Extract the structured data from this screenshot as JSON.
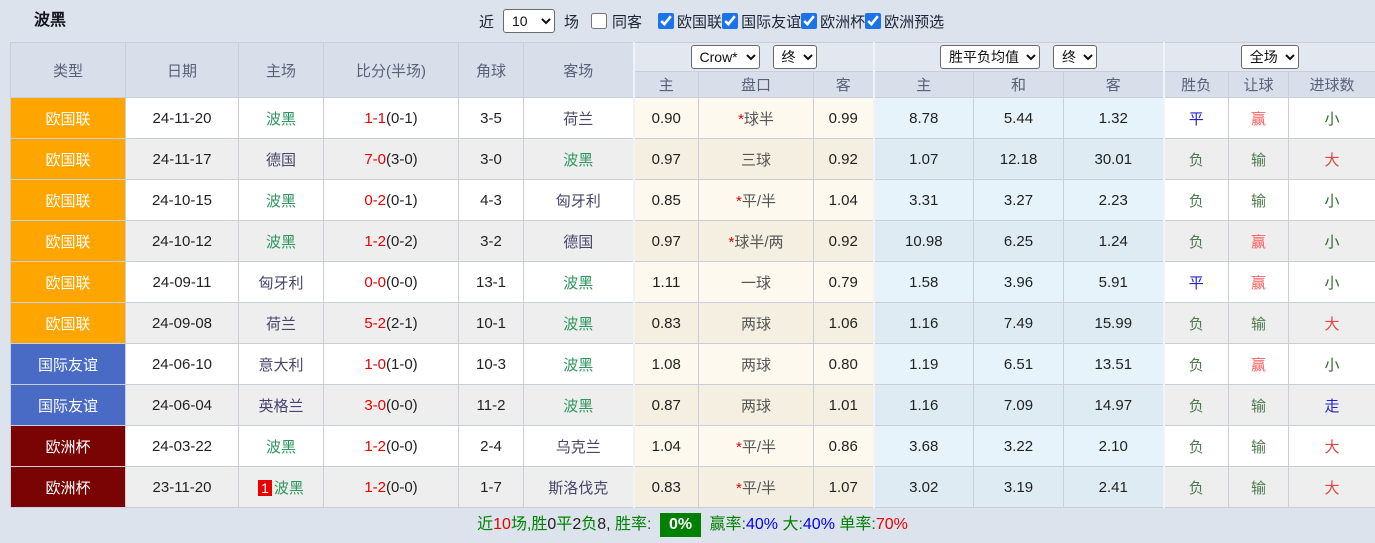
{
  "topbar": {
    "title": "波黑",
    "recent_label": "近",
    "recent_value": "10",
    "games_label": "场",
    "same_venue_label": "同客",
    "same_venue_checked": false,
    "filters": [
      {
        "label": "欧国联",
        "checked": true
      },
      {
        "label": "国际友谊",
        "checked": true
      },
      {
        "label": "欧洲杯",
        "checked": true
      },
      {
        "label": "欧洲预选",
        "checked": true
      }
    ]
  },
  "table": {
    "columns": [
      "类型",
      "日期",
      "主场",
      "比分(半场)",
      "角球",
      "客场"
    ],
    "selects": {
      "company": "Crow*",
      "time1": "终",
      "avg": "胜平负均值",
      "time2": "终",
      "scope": "全场"
    },
    "sub_headers": [
      "主",
      "盘口",
      "客",
      "主",
      "和",
      "客",
      "胜负",
      "让球",
      "进球数"
    ],
    "rows": [
      {
        "type": "欧国联",
        "type_key": "nations",
        "date": "24-11-20",
        "home": "波黑",
        "home_self": true,
        "home_badge": null,
        "score": "1-1",
        "half": "(0-1)",
        "corner": "3-5",
        "away": "荷兰",
        "away_self": false,
        "o_home": "0.90",
        "h_star": true,
        "handicap": "球半",
        "o_away": "0.99",
        "a_home": "8.78",
        "a_draw": "5.44",
        "a_away": "1.32",
        "res": "平",
        "res_c": "blue",
        "hres": "赢",
        "hres_c": "lightred",
        "goal": "小",
        "goal_c": "darkgreen"
      },
      {
        "type": "欧国联",
        "type_key": "nations",
        "date": "24-11-17",
        "home": "德国",
        "home_self": false,
        "home_badge": null,
        "score": "7-0",
        "half": "(3-0)",
        "corner": "3-0",
        "away": "波黑",
        "away_self": true,
        "o_home": "0.97",
        "h_star": false,
        "handicap": "三球",
        "o_away": "0.92",
        "a_home": "1.07",
        "a_draw": "12.18",
        "a_away": "30.01",
        "res": "负",
        "res_c": "green",
        "hres": "输",
        "hres_c": "green",
        "goal": "大",
        "goal_c": "red"
      },
      {
        "type": "欧国联",
        "type_key": "nations",
        "date": "24-10-15",
        "home": "波黑",
        "home_self": true,
        "home_badge": null,
        "score": "0-2",
        "half": "(0-1)",
        "corner": "4-3",
        "away": "匈牙利",
        "away_self": false,
        "o_home": "0.85",
        "h_star": true,
        "handicap": "平/半",
        "o_away": "1.04",
        "a_home": "3.31",
        "a_draw": "3.27",
        "a_away": "2.23",
        "res": "负",
        "res_c": "green",
        "hres": "输",
        "hres_c": "green",
        "goal": "小",
        "goal_c": "darkgreen"
      },
      {
        "type": "欧国联",
        "type_key": "nations",
        "date": "24-10-12",
        "home": "波黑",
        "home_self": true,
        "home_badge": null,
        "score": "1-2",
        "half": "(0-2)",
        "corner": "3-2",
        "away": "德国",
        "away_self": false,
        "o_home": "0.97",
        "h_star": true,
        "handicap": "球半/两",
        "o_away": "0.92",
        "a_home": "10.98",
        "a_draw": "6.25",
        "a_away": "1.24",
        "res": "负",
        "res_c": "green",
        "hres": "赢",
        "hres_c": "lightred",
        "goal": "小",
        "goal_c": "darkgreen"
      },
      {
        "type": "欧国联",
        "type_key": "nations",
        "date": "24-09-11",
        "home": "匈牙利",
        "home_self": false,
        "home_badge": null,
        "score": "0-0",
        "half": "(0-0)",
        "corner": "13-1",
        "away": "波黑",
        "away_self": true,
        "o_home": "1.11",
        "h_star": false,
        "handicap": "一球",
        "o_away": "0.79",
        "a_home": "1.58",
        "a_draw": "3.96",
        "a_away": "5.91",
        "res": "平",
        "res_c": "blue",
        "hres": "赢",
        "hres_c": "lightred",
        "goal": "小",
        "goal_c": "darkgreen"
      },
      {
        "type": "欧国联",
        "type_key": "nations",
        "date": "24-09-08",
        "home": "荷兰",
        "home_self": false,
        "home_badge": null,
        "score": "5-2",
        "half": "(2-1)",
        "corner": "10-1",
        "away": "波黑",
        "away_self": true,
        "o_home": "0.83",
        "h_star": false,
        "handicap": "两球",
        "o_away": "1.06",
        "a_home": "1.16",
        "a_draw": "7.49",
        "a_away": "15.99",
        "res": "负",
        "res_c": "green",
        "hres": "输",
        "hres_c": "green",
        "goal": "大",
        "goal_c": "red"
      },
      {
        "type": "国际友谊",
        "type_key": "friendly",
        "date": "24-06-10",
        "home": "意大利",
        "home_self": false,
        "home_badge": null,
        "score": "1-0",
        "half": "(1-0)",
        "corner": "10-3",
        "away": "波黑",
        "away_self": true,
        "o_home": "1.08",
        "h_star": false,
        "handicap": "两球",
        "o_away": "0.80",
        "a_home": "1.19",
        "a_draw": "6.51",
        "a_away": "13.51",
        "res": "负",
        "res_c": "green",
        "hres": "赢",
        "hres_c": "lightred",
        "goal": "小",
        "goal_c": "darkgreen"
      },
      {
        "type": "国际友谊",
        "type_key": "friendly",
        "date": "24-06-04",
        "home": "英格兰",
        "home_self": false,
        "home_badge": null,
        "score": "3-0",
        "half": "(0-0)",
        "corner": "11-2",
        "away": "波黑",
        "away_self": true,
        "o_home": "0.87",
        "h_star": false,
        "handicap": "两球",
        "o_away": "1.01",
        "a_home": "1.16",
        "a_draw": "7.09",
        "a_away": "14.97",
        "res": "负",
        "res_c": "green",
        "hres": "输",
        "hres_c": "green",
        "goal": "走",
        "goal_c": "blue"
      },
      {
        "type": "欧洲杯",
        "type_key": "euro",
        "date": "24-03-22",
        "home": "波黑",
        "home_self": true,
        "home_badge": null,
        "score": "1-2",
        "half": "(0-0)",
        "corner": "2-4",
        "away": "乌克兰",
        "away_self": false,
        "o_home": "1.04",
        "h_star": true,
        "handicap": "平/半",
        "o_away": "0.86",
        "a_home": "3.68",
        "a_draw": "3.22",
        "a_away": "2.10",
        "res": "负",
        "res_c": "green",
        "hres": "输",
        "hres_c": "green",
        "goal": "大",
        "goal_c": "red"
      },
      {
        "type": "欧洲杯",
        "type_key": "euro",
        "date": "23-11-20",
        "home": "波黑",
        "home_self": true,
        "home_badge": "1",
        "score": "1-2",
        "half": "(0-0)",
        "corner": "1-7",
        "away": "斯洛伐克",
        "away_self": false,
        "o_home": "0.83",
        "h_star": true,
        "handicap": "平/半",
        "o_away": "1.07",
        "a_home": "3.02",
        "a_draw": "3.19",
        "a_away": "2.41",
        "res": "负",
        "res_c": "green",
        "hres": "输",
        "hres_c": "green",
        "goal": "大",
        "goal_c": "red"
      }
    ]
  },
  "footer": {
    "segments": [
      {
        "text": "近",
        "color": "green"
      },
      {
        "text": "10",
        "color": "red"
      },
      {
        "text": "场,胜",
        "color": "green"
      },
      {
        "text": "0",
        "color": "dark"
      },
      {
        "text": "平",
        "color": "green"
      },
      {
        "text": "2",
        "color": "dark"
      },
      {
        "text": "负",
        "color": "green"
      },
      {
        "text": "8, ",
        "color": "dark"
      },
      {
        "text": "胜率: ",
        "color": "green"
      },
      {
        "text": "0%",
        "color": "white",
        "badge": true
      },
      {
        "text": " 赢率:",
        "color": "green"
      },
      {
        "text": "40%",
        "color": "blue"
      },
      {
        "text": " 大:",
        "color": "green"
      },
      {
        "text": "40%",
        "color": "blue"
      },
      {
        "text": " 单率:",
        "color": "green"
      },
      {
        "text": "70%",
        "color": "red"
      }
    ]
  },
  "palette": {
    "league": {
      "nations": "#ffa500",
      "friendly": "#4a6bc5",
      "euro": "#7a0404"
    },
    "team_self": "#2e965d",
    "team_other": "#45456b",
    "score_red": "#e60000",
    "rank_badge_bg": "#e60000",
    "res": {
      "blue": "#2323cc",
      "green": "#507a50",
      "lightred": "#ff5e5e",
      "red": "#e04545",
      "darkgreen": "#2e6b2e"
    },
    "footer": {
      "green": "#008000",
      "red": "#e60000",
      "blue": "#0000ee",
      "dark": "#222222",
      "white": "#ffffff"
    },
    "footer_badge_bg": "#008000"
  }
}
